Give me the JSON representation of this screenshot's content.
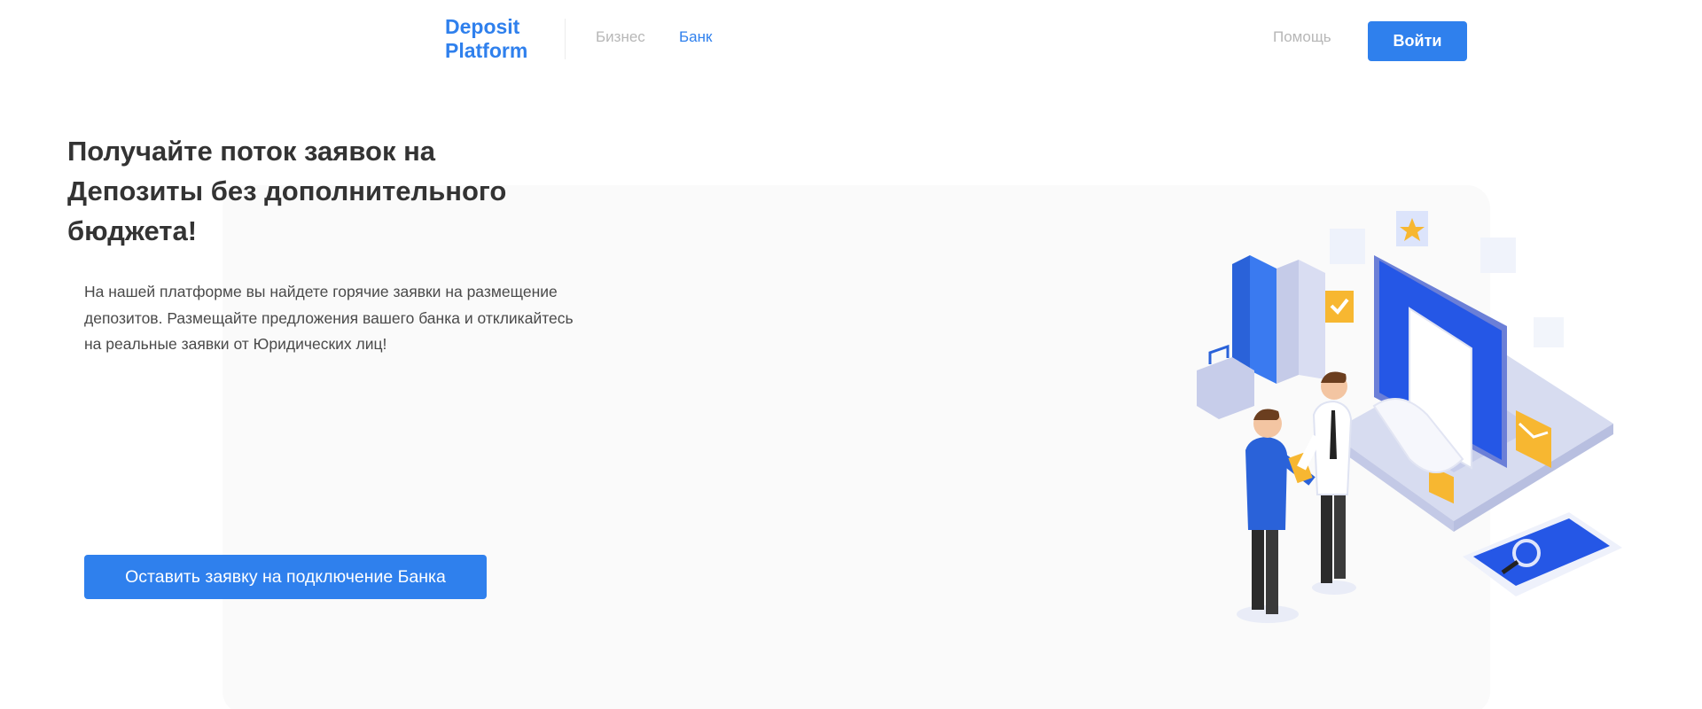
{
  "header": {
    "logo_text": "Deposit Platform",
    "nav": {
      "business": "Бизнес",
      "bank": "Банк",
      "help": "Помощь"
    },
    "login_label": "Войти"
  },
  "hero": {
    "title": "Получайте поток заявок на Депозиты без дополнительного бюджета!",
    "description": "На нашей платформе вы найдете горячие заявки на размещение депозитов. Размещайте предложения вашего банка и откликайтесь на реальные заявки от Юридических лиц!",
    "cta_label": "Оставить заявку на подключение Банка"
  },
  "colors": {
    "accent": "#2f80ed",
    "muted_link": "#b7b7b7",
    "panel": "#fafafa",
    "title": "#333333"
  },
  "illustration": {
    "name": "business-handshake-laptop-illustration"
  }
}
